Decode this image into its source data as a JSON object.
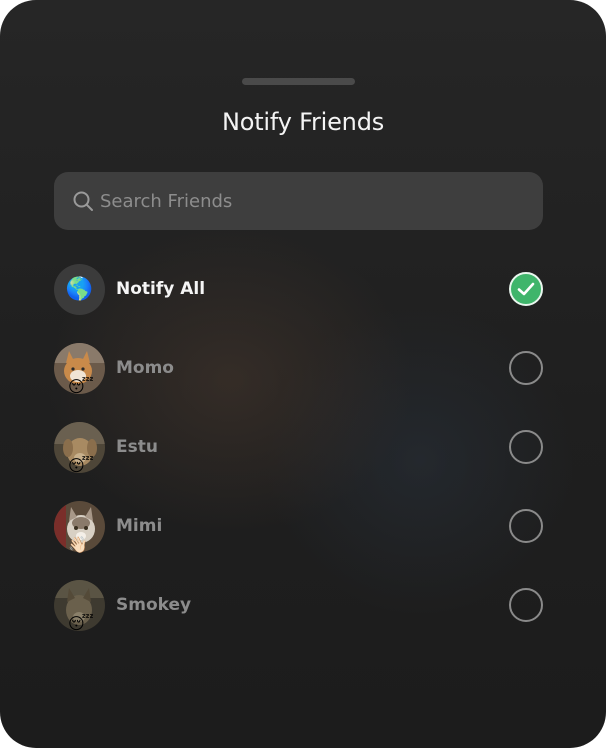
{
  "sheet": {
    "title": "Notify Friends"
  },
  "search": {
    "placeholder": "Search Friends",
    "icon": "search-icon"
  },
  "friends": [
    {
      "name": "Notify All",
      "avatar": "globe-emoji",
      "glyph": "🌎",
      "selected": true
    },
    {
      "name": "Momo",
      "avatar": "cat-photo",
      "badge": "😴",
      "selected": false
    },
    {
      "name": "Estu",
      "avatar": "dog-photo",
      "badge": "😴",
      "selected": false
    },
    {
      "name": "Mimi",
      "avatar": "cat-photo",
      "badge": "👋🏻",
      "selected": false
    },
    {
      "name": "Smokey",
      "avatar": "dog-photo",
      "badge": "😴",
      "selected": false
    }
  ],
  "colors": {
    "accent": "#3fb56b",
    "background": "#222222",
    "search_bg": "#3e3e3e"
  }
}
